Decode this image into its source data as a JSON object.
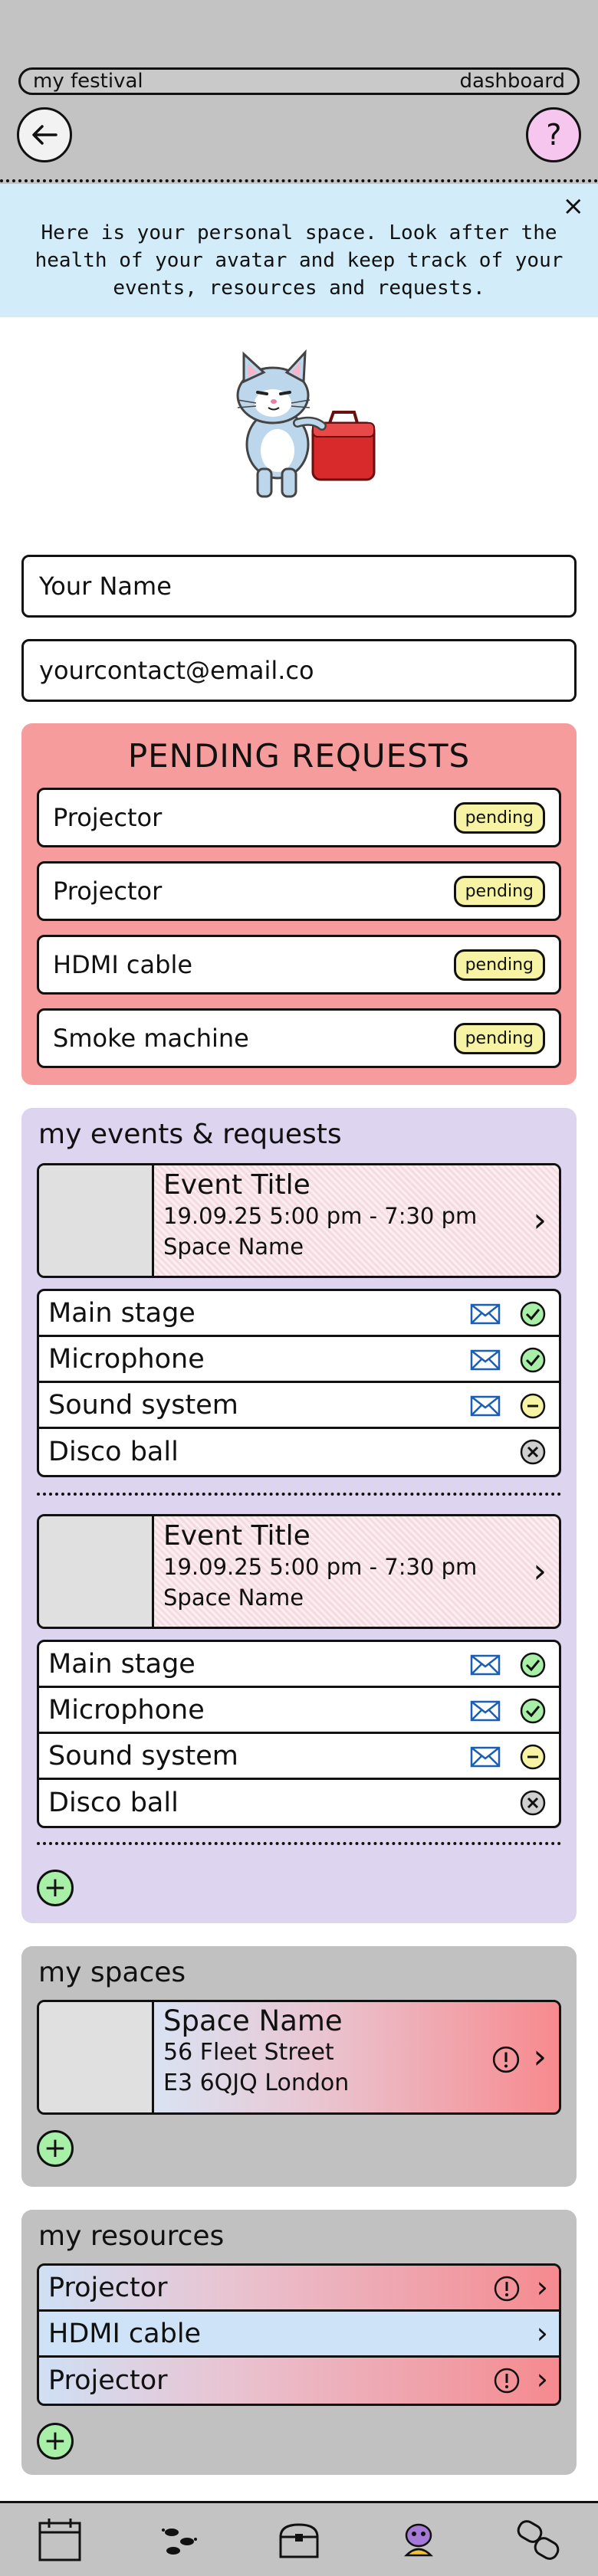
{
  "header": {
    "app_name": "my festival",
    "page_label": "dashboard",
    "back_icon": "arrow-left-icon",
    "help_label": "?"
  },
  "banner": {
    "text": "Here is your personal space. Look after the health of your avatar and keep track of your events, resources and requests.",
    "close_label": "×"
  },
  "profile": {
    "avatar_icon": "cat-avatar-with-suitcase",
    "name_value": "Your Name",
    "email_value": "yourcontact@email.co"
  },
  "pending_requests": {
    "title": "PENDING REQUESTS",
    "items": [
      {
        "name": "Projector",
        "status": "pending"
      },
      {
        "name": "Projector",
        "status": "pending"
      },
      {
        "name": "HDMI cable",
        "status": "pending"
      },
      {
        "name": "Smoke machine",
        "status": "pending"
      }
    ]
  },
  "events": {
    "title": "my events & requests",
    "list": [
      {
        "title": "Event Title",
        "time": "19.09.25 5:00 pm - 7:30 pm",
        "space": "Space Name",
        "requests": [
          {
            "name": "Main stage",
            "mail": true,
            "status": "approved"
          },
          {
            "name": "Microphone",
            "mail": true,
            "status": "approved"
          },
          {
            "name": "Sound system",
            "mail": true,
            "status": "pending"
          },
          {
            "name": "Disco ball",
            "mail": false,
            "status": "declined"
          }
        ]
      },
      {
        "title": "Event Title",
        "time": "19.09.25 5:00 pm - 7:30 pm",
        "space": "Space Name",
        "requests": [
          {
            "name": "Main stage",
            "mail": true,
            "status": "approved"
          },
          {
            "name": "Microphone",
            "mail": true,
            "status": "approved"
          },
          {
            "name": "Sound system",
            "mail": true,
            "status": "pending"
          },
          {
            "name": "Disco ball",
            "mail": false,
            "status": "declined"
          }
        ]
      }
    ],
    "add_label": "+"
  },
  "spaces": {
    "title": "my spaces",
    "list": [
      {
        "name": "Space Name",
        "street": "56 Fleet Street",
        "city": "E3 6QJQ London",
        "alert": true
      }
    ],
    "add_label": "+"
  },
  "resources": {
    "title": "my resources",
    "list": [
      {
        "name": "Projector",
        "alert": true
      },
      {
        "name": "HDMI cable",
        "alert": false
      },
      {
        "name": "Projector",
        "alert": true
      }
    ],
    "add_label": "+"
  },
  "nav": {
    "items": [
      "calendar-icon",
      "footprints-icon",
      "treasure-chest-icon",
      "avatar-icon",
      "gamepad-icon"
    ]
  },
  "colors": {
    "pending_bg": "#f69c9c",
    "events_bg": "#ddd5ef",
    "banner_bg": "#d3ecf9",
    "badge_bg": "#f6f3a5",
    "add_btn": "#a8f0a8",
    "approved": "#a8f0a8",
    "pending": "#f6f3a5",
    "declined": "#cfcfcf"
  }
}
